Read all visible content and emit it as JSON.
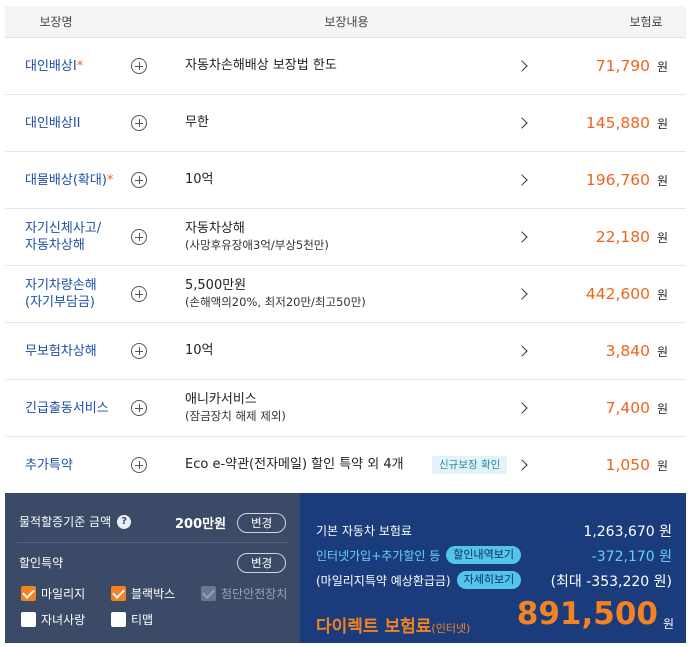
{
  "table": {
    "headers": {
      "name": "보장명",
      "content": "보장내용",
      "premium": "보험료"
    },
    "currency": "원",
    "rows": [
      {
        "name": "대인배상I",
        "star": "*",
        "line1": "자동차손해배상 보장법 한도",
        "line2": "",
        "badge": "",
        "amount": "71,790"
      },
      {
        "name": "대인배상II",
        "star": "",
        "line1": "무한",
        "line2": "",
        "badge": "",
        "amount": "145,880"
      },
      {
        "name": "대물배상(확대)",
        "star": "*",
        "line1": "10억",
        "line2": "",
        "badge": "",
        "amount": "196,760"
      },
      {
        "name": "자기신체사고/",
        "name2": "자동차상해",
        "star": "",
        "line1": "자동차상해",
        "line2": "(사망후유장애3억/부상5천만)",
        "badge": "",
        "amount": "22,180"
      },
      {
        "name": "자기차량손해",
        "name2": "(자기부담금)",
        "star": "",
        "line1": "5,500만원",
        "line2": "(손해액의20%, 최저20만/최고50만)",
        "badge": "",
        "amount": "442,600"
      },
      {
        "name": "무보험차상해",
        "star": "",
        "line1": "10억",
        "line2": "",
        "badge": "",
        "amount": "3,840"
      },
      {
        "name": "긴급출동서비스",
        "star": "",
        "line1": "애니카서비스",
        "line2": "(잠금장치 해제 제외)",
        "badge": "",
        "amount": "7,400"
      },
      {
        "name": "추가특약",
        "star": "",
        "line1": "Eco e-약관(전자메일) 할인 특약 외 4개",
        "line2": "",
        "badge": "신규보장 확인",
        "amount": "1,050"
      }
    ]
  },
  "footer": {
    "left": {
      "criteria_label": "물적할증기준 금액",
      "criteria_value": "200만원",
      "change_label": "변경",
      "discount_label": "할인특약",
      "discount_change_label": "변경",
      "options": [
        {
          "label": "마일리지",
          "state": "checked"
        },
        {
          "label": "블랙박스",
          "state": "checked"
        },
        {
          "label": "첨단안전장치",
          "state": "disabled"
        },
        {
          "label": "자녀사랑",
          "state": "unchecked"
        },
        {
          "label": "티맵",
          "state": "unchecked"
        }
      ]
    },
    "right": {
      "base_label": "기본 자동차 보험료",
      "base_amount": "1,263,670 원",
      "discount_label": "인터넷가입+추가할인 등",
      "discount_button": "할인내역보기",
      "discount_amount": "-372,170 원",
      "mileage_label": "(마일리지특약 예상환급금)",
      "mileage_button": "자세히보기",
      "mileage_amount": "(최대 -353,220 원)",
      "final_label": "다이렉트 보험료",
      "final_label_small": "(인터넷)",
      "final_amount": "891,500",
      "final_won": "원"
    }
  },
  "colors": {
    "accent_orange": "#f58220",
    "name_blue": "#1b4fa3",
    "footer_navy": "#1a3c7c",
    "footer_slate": "#3b4a66",
    "cyan": "#63d3f5"
  }
}
